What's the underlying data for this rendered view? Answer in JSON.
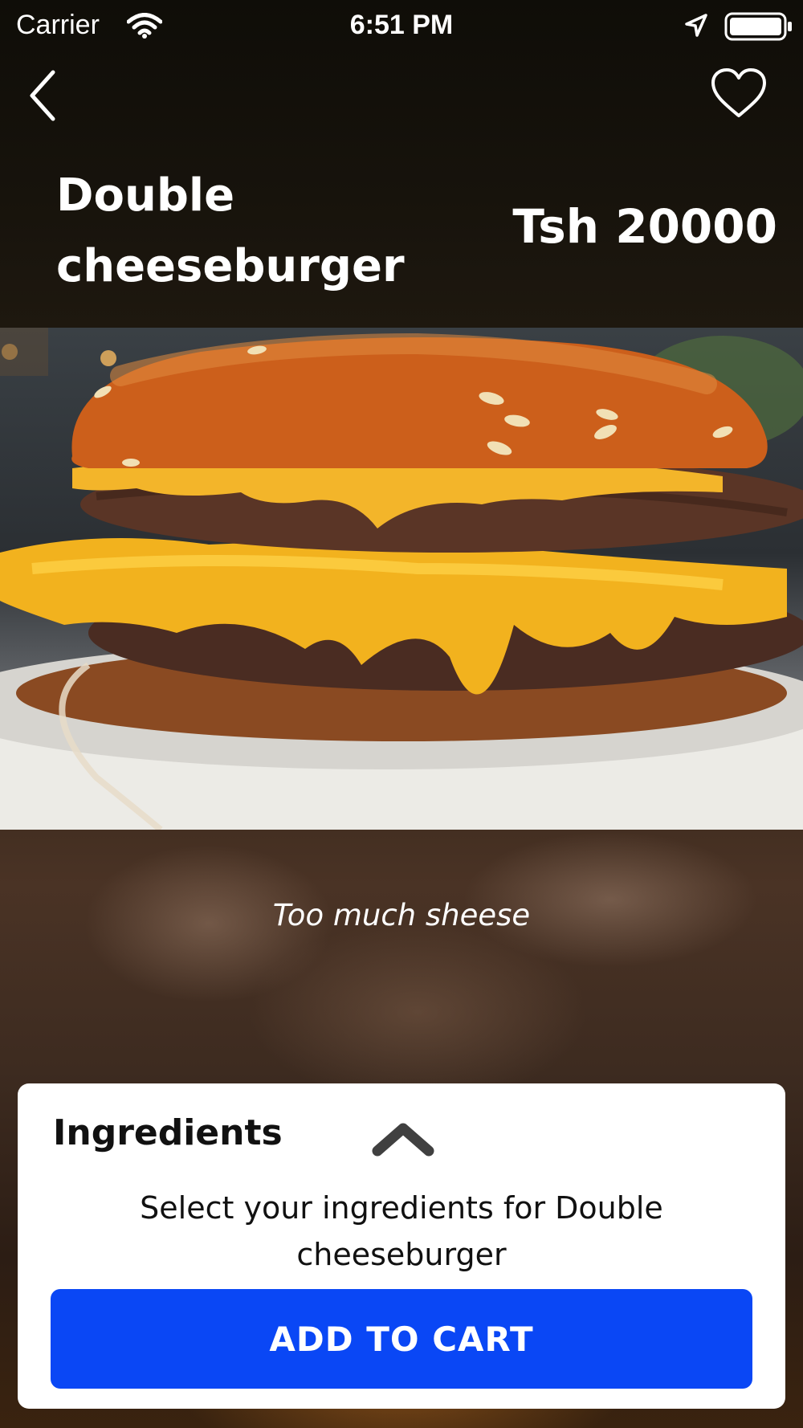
{
  "status_bar": {
    "carrier": "Carrier",
    "time": "6:51 PM",
    "icons": [
      "wifi-icon",
      "location-arrow-icon",
      "battery-icon"
    ]
  },
  "nav": {
    "back_icon": "chevron-left-icon",
    "favorite_icon": "heart-outline-icon"
  },
  "product": {
    "name": "Double cheeseburger",
    "price": "Tsh 20000",
    "description": "Too much sheese"
  },
  "ingredients_panel": {
    "title": "Ingredients",
    "toggle_icon": "chevron-up-icon",
    "prompt": "Select your ingredients for Double cheeseburger",
    "add_to_cart_label": "ADD TO CART"
  },
  "colors": {
    "primary_button": "#0a47f5",
    "text_light": "#ffffff",
    "card_background": "#ffffff"
  }
}
